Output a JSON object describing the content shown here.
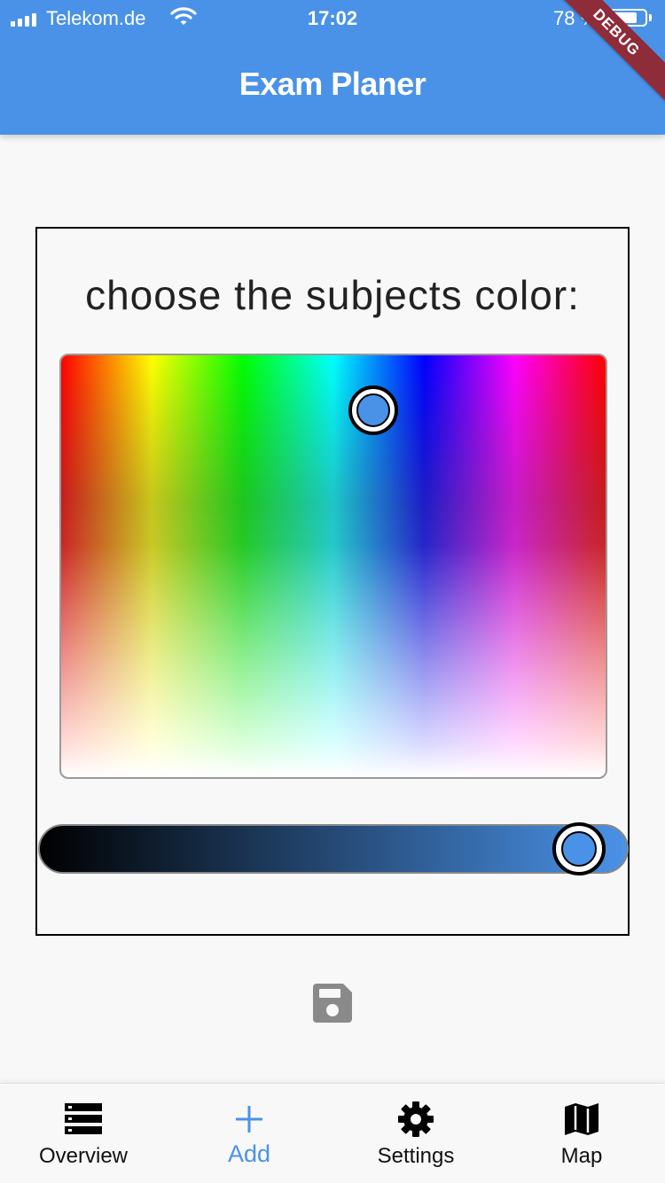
{
  "status_bar": {
    "carrier": "Telekom.de",
    "time": "17:02",
    "battery_text": "78 %",
    "battery_level": 0.78
  },
  "app_bar": {
    "title": "Exam Planer"
  },
  "debug_banner": "DEBUG",
  "picker": {
    "prompt": "choose the subjects color:",
    "selected_color": "#4a92e8"
  },
  "save_icon": "floppy-disk-icon",
  "bottom_nav": {
    "active": "Add",
    "items": [
      {
        "label": "Overview",
        "icon": "list-icon"
      },
      {
        "label": "Add",
        "icon": "plus-icon"
      },
      {
        "label": "Settings",
        "icon": "gear-icon"
      },
      {
        "label": "Map",
        "icon": "map-icon"
      }
    ]
  },
  "colors": {
    "primary": "#4a92e8",
    "debug_ribbon": "#8e2c3a"
  }
}
